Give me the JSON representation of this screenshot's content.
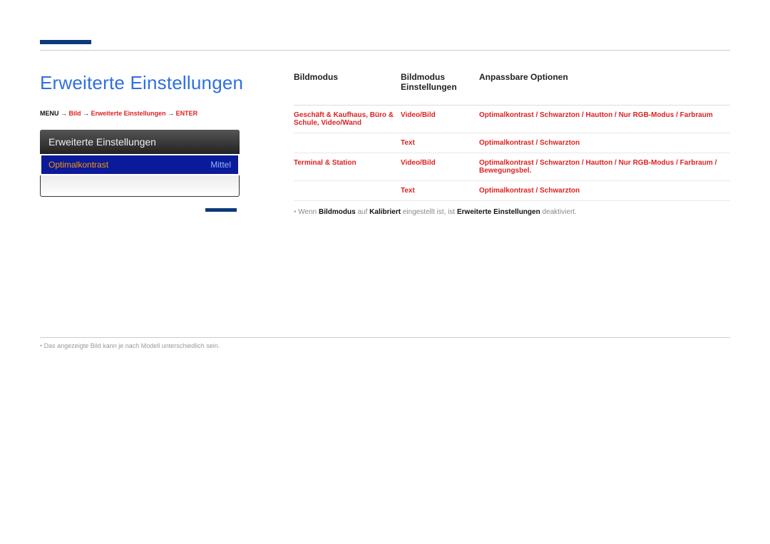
{
  "header": {
    "page_title": "Erweiterte Einstellungen"
  },
  "breadcrumb": {
    "prefix": "MENU",
    "arrow": "→",
    "seg1": "Bild",
    "seg2": "Erweiterte Einstellungen",
    "seg3": "ENTER"
  },
  "preview": {
    "title": "Erweiterte Einstellungen",
    "row_label": "Optimalkontrast",
    "row_value": "Mittel"
  },
  "table": {
    "headers": {
      "c1": "Bildmodus",
      "c2": "Bildmodus Einstellungen",
      "c3": "Anpassbare Optionen"
    },
    "rows": [
      {
        "c1": "Geschäft & Kaufhaus, Büro & Schule, Video/Wand",
        "c2": "Video/Bild",
        "c3": "Optimalkontrast / Schwarzton / Hautton / Nur RGB-Modus / Farbraum"
      },
      {
        "c1": "",
        "c2": "Text",
        "c3": "Optimalkontrast / Schwarzton"
      },
      {
        "c1": "Terminal & Station",
        "c2": "Video/Bild",
        "c3": "Optimalkontrast / Schwarzton / Hautton / Nur RGB-Modus / Farbraum / Bewegungsbel."
      },
      {
        "c1": "",
        "c2": "Text",
        "c3": "Optimalkontrast / Schwarzton"
      }
    ]
  },
  "note": {
    "pre": "Wenn ",
    "k1": "Bildmodus",
    "mid1": " auf ",
    "k2": "Kalibriert",
    "mid2": " eingestellt ist, ist ",
    "k3": "Erweiterte Einstellungen",
    "post": " deaktiviert."
  },
  "footer": {
    "note": "Das angezeigte Bild kann je nach Modell unterschiedlich sein."
  }
}
